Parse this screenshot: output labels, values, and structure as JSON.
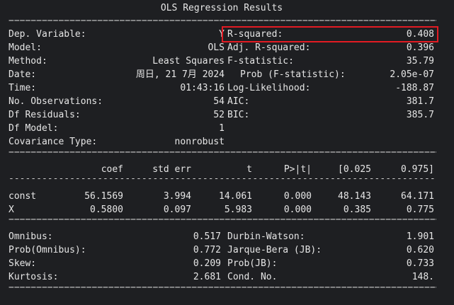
{
  "title": "OLS Regression Results",
  "rule_double": "=================================================================================",
  "rule_single": "---------------------------------------------------------------------------------",
  "top_left": [
    {
      "label": "Dep. Variable:",
      "value": "Y"
    },
    {
      "label": "Model:",
      "value": "OLS"
    },
    {
      "label": "Method:",
      "value": "Least Squares"
    },
    {
      "label": "Date:",
      "value": "周日, 21 7月 2024"
    },
    {
      "label": "Time:",
      "value": "01:43:16"
    },
    {
      "label": "No. Observations:",
      "value": "54"
    },
    {
      "label": "Df Residuals:",
      "value": "52"
    },
    {
      "label": "Df Model:",
      "value": "1"
    },
    {
      "label": "Covariance Type:",
      "value": "nonrobust"
    }
  ],
  "top_right": [
    {
      "label": "R-squared:",
      "value": "0.408"
    },
    {
      "label": "Adj. R-squared:",
      "value": "0.396"
    },
    {
      "label": "F-statistic:",
      "value": "35.79"
    },
    {
      "label": "Prob (F-statistic):",
      "value": "2.05e-07"
    },
    {
      "label": "Log-Likelihood:",
      "value": "-188.87"
    },
    {
      "label": "AIC:",
      "value": "381.7"
    },
    {
      "label": "BIC:",
      "value": "385.7"
    }
  ],
  "coef_headers": [
    "coef",
    "std err",
    "t",
    "P>|t|",
    "[0.025",
    "0.975]"
  ],
  "coef_rows": [
    {
      "name": "const",
      "values": [
        "56.1569",
        "3.994",
        "14.061",
        "0.000",
        "48.143",
        "64.171"
      ]
    },
    {
      "name": "X",
      "values": [
        "0.5800",
        "0.097",
        "5.983",
        "0.000",
        "0.385",
        "0.775"
      ]
    }
  ],
  "bottom_left": [
    {
      "label": "Omnibus:",
      "value": "0.517"
    },
    {
      "label": "Prob(Omnibus):",
      "value": "0.772"
    },
    {
      "label": "Skew:",
      "value": "0.209"
    },
    {
      "label": "Kurtosis:",
      "value": "2.681"
    }
  ],
  "bottom_right": [
    {
      "label": "Durbin-Watson:",
      "value": "1.901"
    },
    {
      "label": "Jarque-Bera (JB):",
      "value": "0.620"
    },
    {
      "label": "Prob(JB):",
      "value": "0.733"
    },
    {
      "label": "Cond. No.",
      "value": "148."
    }
  ],
  "highlight_color": "#e31b23",
  "background_color": "#1e1f22"
}
